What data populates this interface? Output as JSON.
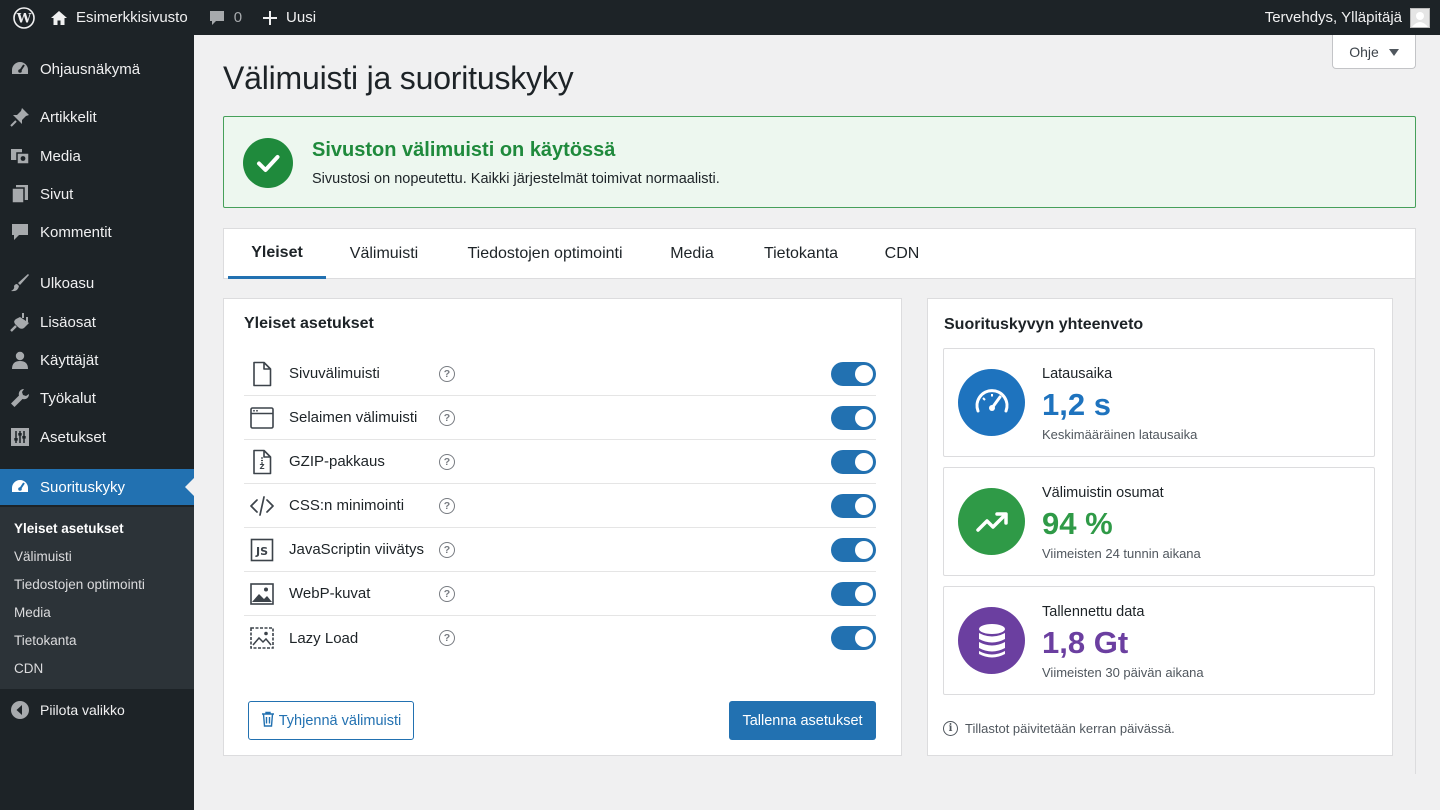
{
  "adminbar": {
    "site_name": "Esimerkkisivusto",
    "comments_count": "0",
    "new_label": "Uusi",
    "greeting": "Tervehdys, Ylläpitäjä"
  },
  "sidebar": {
    "items": [
      {
        "label": "Ohjausnäkymä",
        "icon": "dashboard-icon"
      },
      {
        "label": "Artikkelit",
        "icon": "pin-icon"
      },
      {
        "label": "Media",
        "icon": "media-icon"
      },
      {
        "label": "Sivut",
        "icon": "pages-icon"
      },
      {
        "label": "Kommentit",
        "icon": "comment-icon"
      },
      {
        "label": "Ulkoasu",
        "icon": "brush-icon"
      },
      {
        "label": "Lisäosat",
        "icon": "plugin-icon"
      },
      {
        "label": "Käyttäjät",
        "icon": "users-icon"
      },
      {
        "label": "Työkalut",
        "icon": "wrench-icon"
      },
      {
        "label": "Asetukset",
        "icon": "settings-icon"
      },
      {
        "label": "Suorituskyky",
        "icon": "gauge-icon"
      }
    ],
    "submenu": [
      "Yleiset asetukset",
      "Välimuisti",
      "Tiedostojen optimointi",
      "Media",
      "Tietokanta",
      "CDN"
    ],
    "collapse_label": "Piilota valikko"
  },
  "help_label": "Ohje",
  "page_title": "Välimuisti ja suorituskyky",
  "notice": {
    "title": "Sivuston välimuisti on käytössä",
    "text": "Sivustosi on nopeutettu. Kaikki järjestelmät toimivat normaalisti."
  },
  "tabs": [
    "Yleiset",
    "Välimuisti",
    "Tiedostojen optimointi",
    "Media",
    "Tietokanta",
    "CDN"
  ],
  "general": {
    "title": "Yleiset asetukset",
    "settings": [
      {
        "label": "Sivuvälimuisti",
        "icon": "page-icon",
        "enabled": true
      },
      {
        "label": "Selaimen välimuisti",
        "icon": "browser-icon",
        "enabled": true
      },
      {
        "label": "GZIP-pakkaus",
        "icon": "zip-file-icon",
        "enabled": true
      },
      {
        "label": "CSS:n minimointi",
        "icon": "code-icon",
        "enabled": true
      },
      {
        "label": "JavaScriptin viivätys",
        "icon": "js-icon",
        "enabled": true
      },
      {
        "label": "WebP-kuvat",
        "icon": "image-icon",
        "enabled": true
      },
      {
        "label": "Lazy Load",
        "icon": "lazy-image-icon",
        "enabled": true
      }
    ],
    "help_glyph": "?",
    "clear_label": "Tyhjennä välimuisti",
    "save_label": "Tallenna asetukset"
  },
  "summary": {
    "title": "Suorituskyvyn yhteenveto",
    "cards": [
      {
        "name": "Latausaika",
        "value": "1,2 s",
        "sub": "Keskimääräinen latausaika",
        "color": "#1e73be"
      },
      {
        "name": "Välimuistin osumat",
        "value": "94 %",
        "sub": "Viimeisten 24 tunnin aikana",
        "color": "#2f9a47"
      },
      {
        "name": "Tallennettu data",
        "value": "1,8 Gt",
        "sub": "Viimeisten 30 päivän aikana",
        "color": "#6b3fa0"
      }
    ],
    "footnote": "Tillastot päivitetään kerran päivässä."
  },
  "colors": {
    "accent": "#2271b1",
    "success": "#1f8a3c",
    "sidebar": "#1d2327"
  }
}
